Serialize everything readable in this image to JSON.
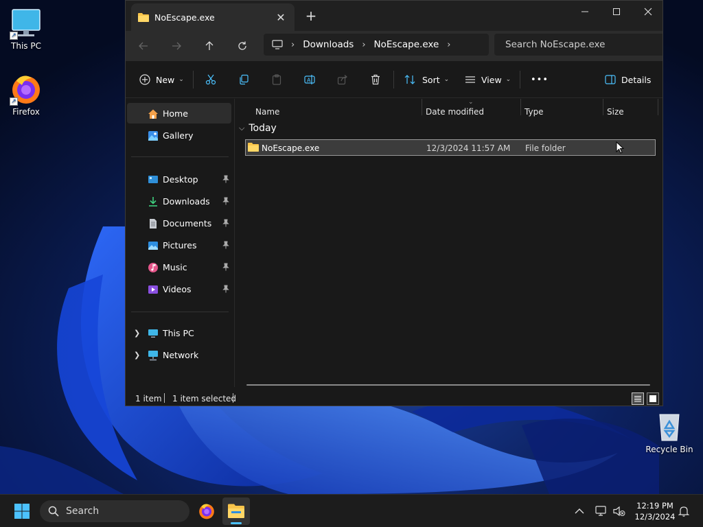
{
  "desktop": {
    "icons": [
      {
        "label": "This PC"
      },
      {
        "label": "Firefox"
      },
      {
        "label": "Recycle Bin"
      }
    ]
  },
  "window": {
    "tab_title": "NoEscape.exe",
    "tab_close": "✕",
    "new_tab": "+",
    "breadcrumb": [
      "Downloads",
      "NoEscape.exe"
    ],
    "search_placeholder": "Search NoEscape.exe",
    "toolbar": {
      "new_label": "New",
      "sort_label": "Sort",
      "view_label": "View",
      "more_label": "•••",
      "details_label": "Details"
    },
    "sidebar": {
      "items": [
        {
          "label": "Home"
        },
        {
          "label": "Gallery"
        },
        {
          "label": "Desktop"
        },
        {
          "label": "Downloads"
        },
        {
          "label": "Documents"
        },
        {
          "label": "Pictures"
        },
        {
          "label": "Music"
        },
        {
          "label": "Videos"
        },
        {
          "label": "This PC"
        },
        {
          "label": "Network"
        }
      ]
    },
    "columns": [
      "Name",
      "Date modified",
      "Type",
      "Size"
    ],
    "group_header": "Today",
    "files": [
      {
        "name": "NoEscape.exe",
        "date": "12/3/2024 11:57 AM",
        "type": "File folder",
        "size": ""
      }
    ],
    "status": {
      "count": "1 item",
      "selected": "1 item selected"
    }
  },
  "taskbar": {
    "search_label": "Search",
    "time": "12:19 PM",
    "date": "12/3/2024"
  },
  "colors": {
    "folder_yellow": "#f8c44a",
    "window_bg": "#191919",
    "selection_bg": "#3c3c3c",
    "accent_blue": "#4cc2ff"
  }
}
